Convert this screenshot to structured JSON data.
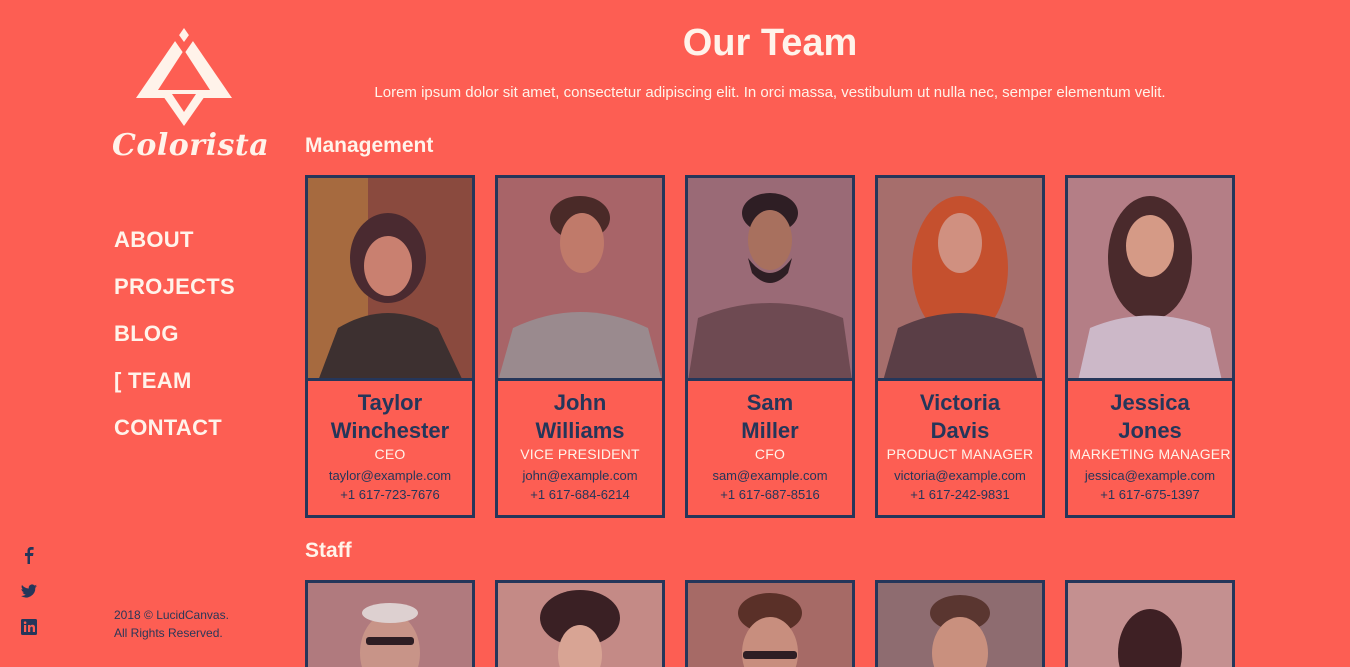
{
  "brand": {
    "name": "Colorista"
  },
  "nav": {
    "items": [
      "ABOUT",
      "PROJECTS",
      "BLOG",
      "[ TEAM",
      "CONTACT"
    ]
  },
  "footer": {
    "line1": "2018 © LucidCanvas.",
    "line2": "All Rights Reserved."
  },
  "social": [
    "facebook-icon",
    "twitter-icon",
    "linkedin-icon"
  ],
  "header": {
    "title": "Our Team",
    "subtitle": "Lorem ipsum dolor sit amet, consectetur adipiscing elit. In orci massa, vestibulum ut nulla nec, semper elementum velit."
  },
  "sections": {
    "management": {
      "title": "Management",
      "members": [
        {
          "first": "Taylor",
          "last": "Winchester",
          "role": "CEO",
          "email": "taylor@example.com",
          "phone": "+1 617-723-7676"
        },
        {
          "first": "John",
          "last": "Williams",
          "role": "VICE PRESIDENT",
          "email": "john@example.com",
          "phone": "+1 617-684-6214"
        },
        {
          "first": "Sam",
          "last": "Miller",
          "role": "CFO",
          "email": "sam@example.com",
          "phone": "+1 617-687-8516"
        },
        {
          "first": "Victoria",
          "last": "Davis",
          "role": "PRODUCT MANAGER",
          "email": "victoria@example.com",
          "phone": "+1 617-242-9831"
        },
        {
          "first": "Jessica",
          "last": "Jones",
          "role": "MARKETING MANAGER",
          "email": "jessica@example.com",
          "phone": "+1 617-675-1397"
        }
      ]
    },
    "staff": {
      "title": "Staff"
    }
  },
  "colors": {
    "background": "#fd5e53",
    "accent": "#25365a",
    "light": "#fff3ea"
  }
}
